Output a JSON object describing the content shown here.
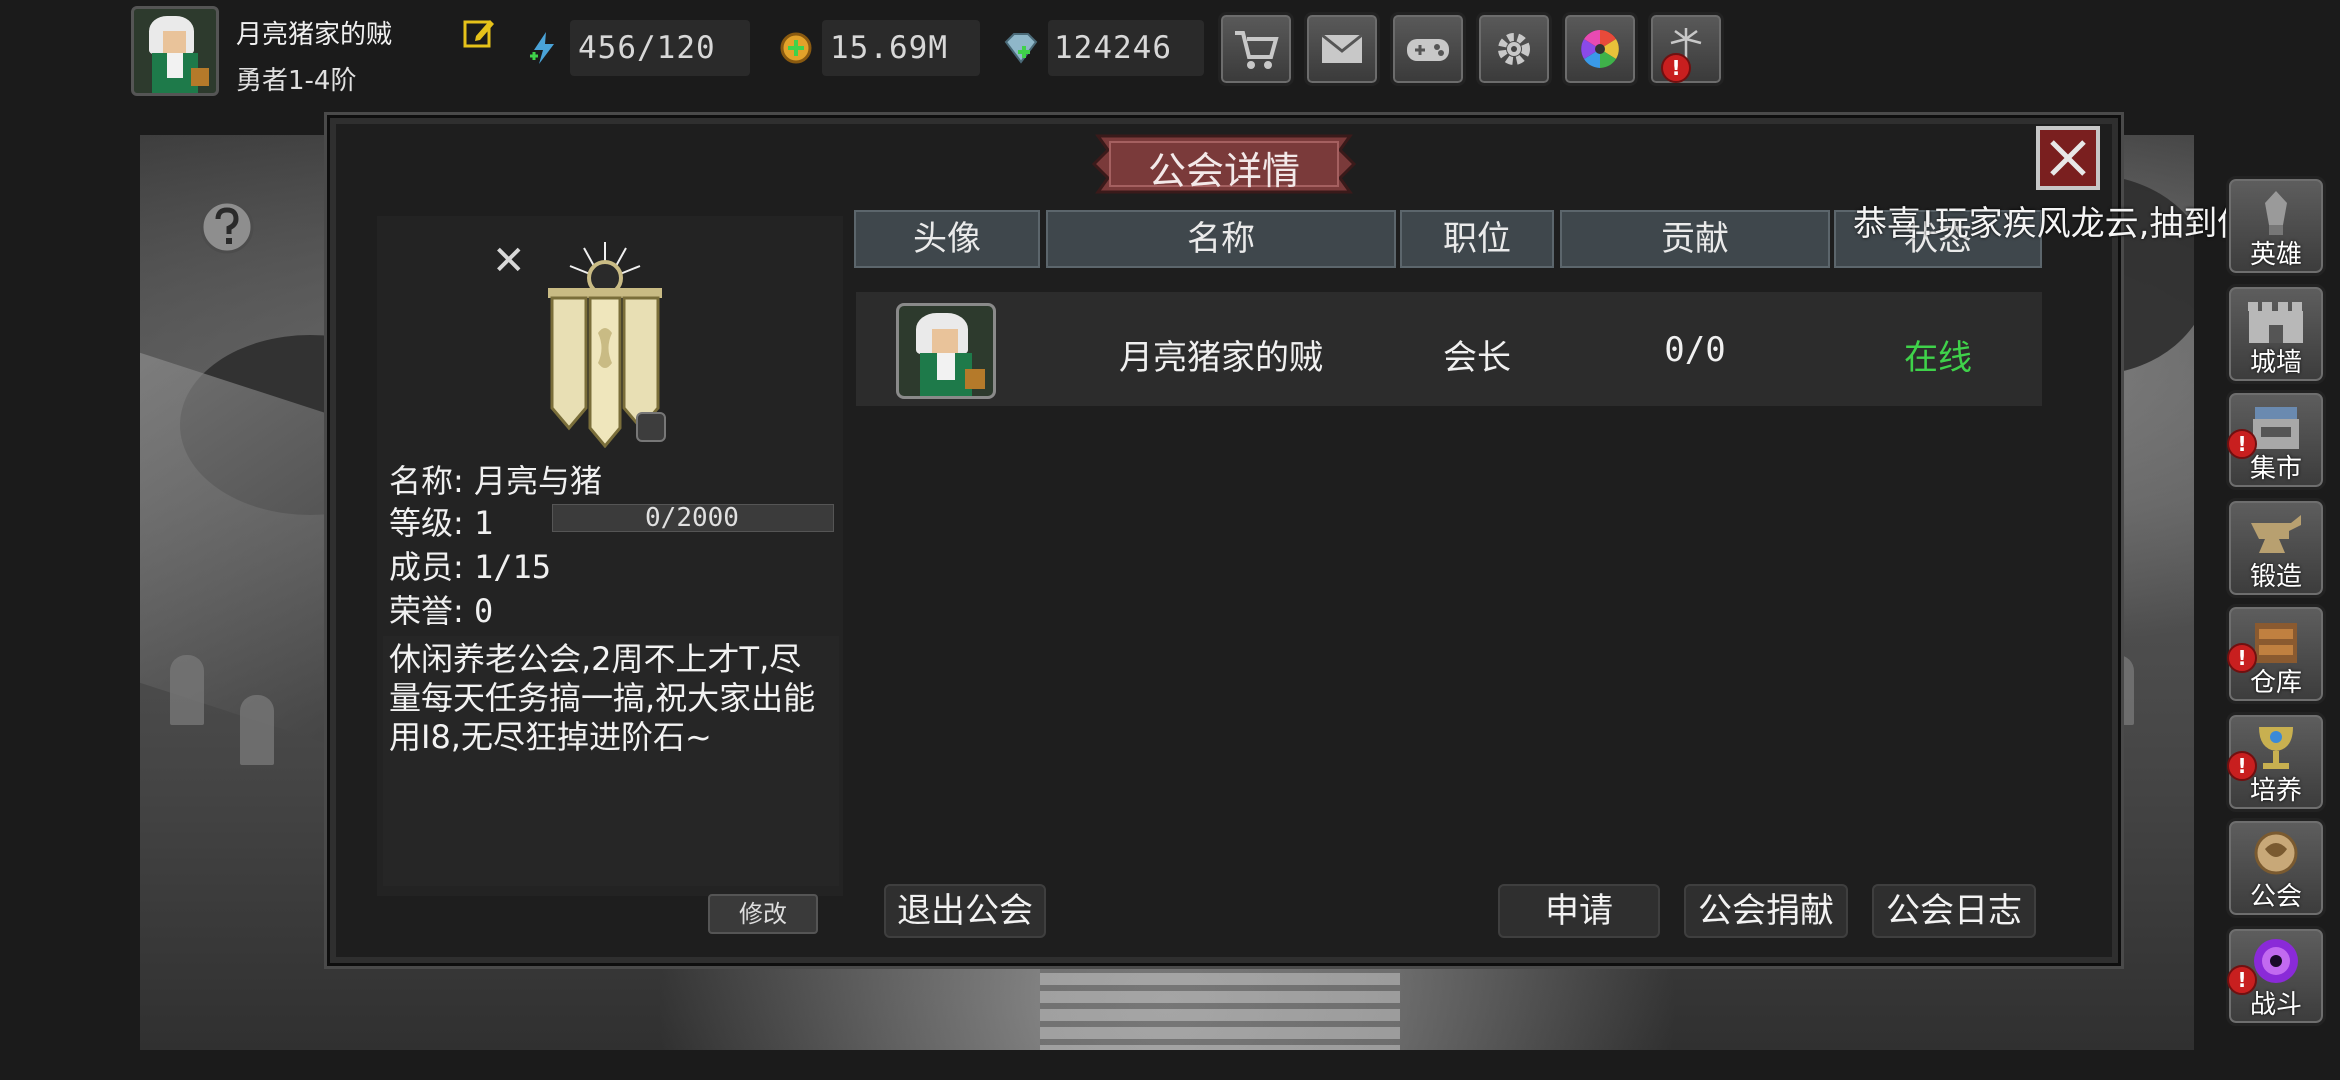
{
  "player": {
    "name": "月亮猪家的贼",
    "rank": "勇者1-4阶"
  },
  "resources": {
    "energy": "456/120",
    "gold": "15.69M",
    "gems": "124246"
  },
  "toolbar": {
    "buttons": [
      "cart-icon",
      "mail-icon",
      "gamepad-icon",
      "gear-icon",
      "color-wheel-icon",
      "firework-icon"
    ]
  },
  "dialog": {
    "title": "公会详情"
  },
  "guild": {
    "name_label": "名称:",
    "name": "月亮与猪",
    "level_label": "等级:",
    "level": "1",
    "exp": "0/2000",
    "exp_fraction": 0,
    "members_label": "成员:",
    "members": "1/15",
    "honor_label": "荣誉:",
    "honor": "0",
    "description": "休闲养老公会,2周不上才T,尽量每天任务搞一搞,祝大家出能用I8,无尽狂掉进阶石~",
    "modify_label": "修改"
  },
  "table": {
    "headers": [
      "头像",
      "名称",
      "职位",
      "贡献",
      "状态"
    ],
    "rows": [
      {
        "name": "月亮猪家的贼",
        "position": "会长",
        "contribution": "0/0",
        "status": "在线"
      }
    ]
  },
  "buttons": {
    "leave": "退出公会",
    "apply": "申请",
    "donate": "公会捐献",
    "log": "公会日志"
  },
  "marquee": "恭喜!玩家疾风龙云,抽到传说",
  "sidebar": {
    "items": [
      {
        "label": "英雄",
        "icon": "hero-icon"
      },
      {
        "label": "城墙",
        "icon": "wall-icon"
      },
      {
        "label": "集市",
        "icon": "market-icon"
      },
      {
        "label": "锻造",
        "icon": "anvil-icon"
      },
      {
        "label": "仓库",
        "icon": "warehouse-icon"
      },
      {
        "label": "培养",
        "icon": "chalice-icon"
      },
      {
        "label": "公会",
        "icon": "guild-icon"
      },
      {
        "label": "战斗",
        "icon": "portal-icon"
      }
    ]
  },
  "colors": {
    "online": "#3fd24a",
    "alert": "#c81f1f",
    "close": "#7a1f1f",
    "banner": "#7a3a3a"
  }
}
